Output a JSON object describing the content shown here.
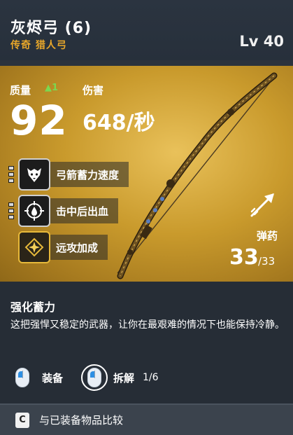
{
  "item": {
    "name": "灰烬弓 (6)",
    "rarity_type": "传奇 猎人弓",
    "level": "Lv 40"
  },
  "stats": {
    "quality_label": "质量",
    "quality_delta": "▲1",
    "quality_value": "92",
    "damage_label": "伤害",
    "damage_value": "648/秒"
  },
  "perks": [
    {
      "label": "弓箭蓄力速度",
      "icon": "wolf-icon",
      "pips_on": 3,
      "pips_total": 3
    },
    {
      "label": "击中后出血",
      "icon": "blood-target-icon",
      "pips_on": 3,
      "pips_total": 3
    },
    {
      "label": "远攻加成",
      "icon": "gold-star-icon",
      "pips_on": 0,
      "pips_total": 0
    }
  ],
  "ammo": {
    "label": "弹药",
    "current": "33",
    "max": "/33"
  },
  "description": {
    "title": "强化蓄力",
    "text": "这把强悍又稳定的武器，让你在最艰难的情况下也能保持冷静。"
  },
  "actions": {
    "equip_label": "装备",
    "dismantle_label": "拆解",
    "dismantle_count": "1/6"
  },
  "footer": {
    "key": "C",
    "compare_label": "与已装备物品比较"
  },
  "colors": {
    "rarity": "#e8a72a",
    "gold_bg": "#c99a2c",
    "delta_green": "#7bd850",
    "mouse_blue": "#2d8fe3"
  }
}
